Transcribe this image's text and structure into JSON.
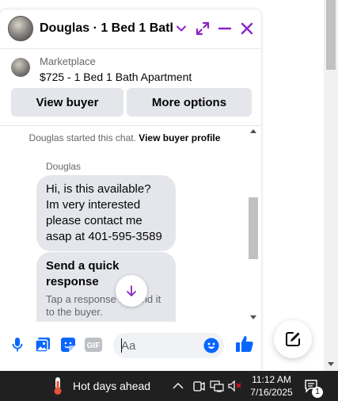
{
  "chat": {
    "title": "Douglas · 1 Bed 1 Bath ...",
    "listing": {
      "source": "Marketplace",
      "price_title": "$725 - 1 Bed 1 Bath Apartment"
    },
    "actions": {
      "view_buyer": "View buyer",
      "more_options": "More options"
    },
    "thread": {
      "system_prefix": "Douglas started this chat. ",
      "system_link": "View buyer profile",
      "sender": "Douglas",
      "message": "Hi, is this available? Im very interested please contact me asap at 401-595-3589",
      "quick_response_title": "Send a quick response",
      "quick_response_sub": "Tap a response to send it to the buyer."
    },
    "composer": {
      "placeholder": "Aa"
    },
    "accent_color": "#8a24c4",
    "like_color": "#0866ff"
  },
  "taskbar": {
    "weather_text": "Hot days ahead",
    "time": "11:12 AM",
    "date": "7/16/2025",
    "notification_count": "1"
  }
}
